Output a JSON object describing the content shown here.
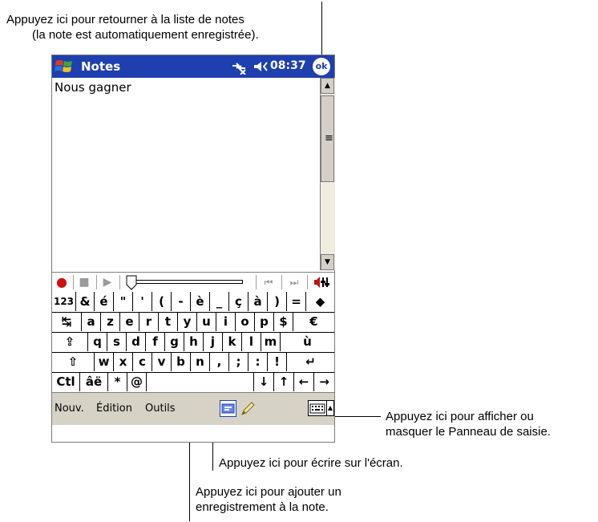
{
  "callouts": {
    "ok_line1": "Appuyez ici pour retourner à la liste de notes",
    "ok_line2": "(la note est automatiquement enregistrée).",
    "sip_line1": "Appuyez ici pour afficher ou",
    "sip_line2": "masquer le Panneau de saisie.",
    "pen": "Appuyez ici pour écrire sur l'écran.",
    "rec_line1": "Appuyez ici pour ajouter un",
    "rec_line2": "enregistrement à la note."
  },
  "titlebar": {
    "app_title": "Notes",
    "time": "08:37",
    "ok_label": "ok",
    "color": "#1e3fb0"
  },
  "note": {
    "text": "Nous gagner"
  },
  "scrollbar": {
    "up": "▲",
    "thumb": "≡",
    "down": "▼"
  },
  "recording_toolbar": {
    "record": "●",
    "stop": "■",
    "play": "▶",
    "skip_back": "⏮",
    "skip_forward": "⏭"
  },
  "keyboard": {
    "row1": [
      "123",
      "&",
      "é",
      "\"",
      "'",
      "(",
      "-",
      "è",
      "_",
      "ç",
      "à",
      ")",
      "=",
      "◆"
    ],
    "row2": [
      "↹",
      "a",
      "z",
      "e",
      "r",
      "t",
      "y",
      "u",
      "i",
      "o",
      "p",
      "$",
      "€"
    ],
    "row3": [
      "⇪",
      "q",
      "s",
      "d",
      "f",
      "g",
      "h",
      "j",
      "k",
      "l",
      "m",
      "ù"
    ],
    "row4": [
      "⇧",
      "w",
      "x",
      "c",
      "v",
      "b",
      "n",
      ",",
      ";",
      ":",
      "!",
      "↵"
    ],
    "row5": [
      "Ctl",
      "âë",
      "*",
      "@",
      "",
      "↓",
      "↑",
      "←",
      "→"
    ]
  },
  "menubar": {
    "new": "Nouv.",
    "edit": "Édition",
    "tools": "Outils",
    "sip_arrow": "▲"
  }
}
